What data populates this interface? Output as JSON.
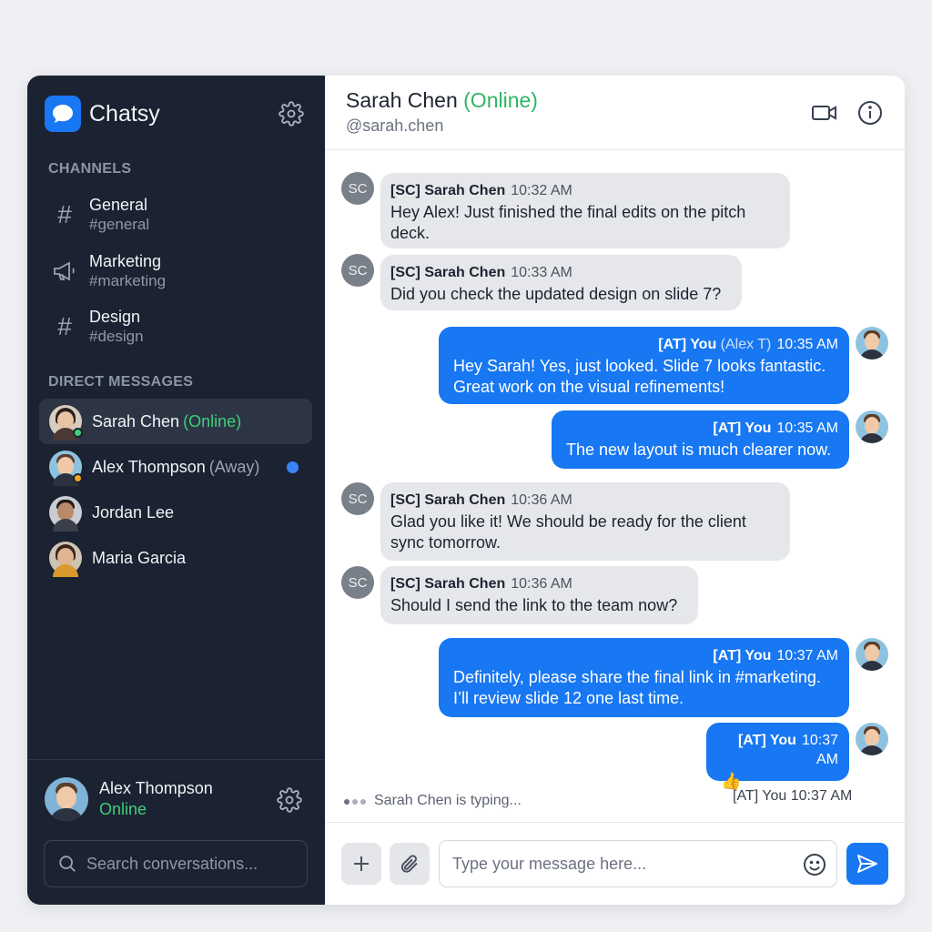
{
  "app": {
    "name": "Chatsy"
  },
  "sidebar": {
    "channels_title": "CHANNELS",
    "channels": [
      {
        "name": "General",
        "handle": "#general",
        "icon": "hash-icon"
      },
      {
        "name": "Marketing",
        "handle": "#marketing",
        "icon": "megaphone-icon"
      },
      {
        "name": "Design",
        "handle": "#design",
        "icon": "hash-icon"
      }
    ],
    "dm_title": "DIRECT MESSAGES",
    "dms": [
      {
        "name": "Sarah Chen",
        "status": "(Online)",
        "status_color": "#3ecf7a",
        "active": true
      },
      {
        "name": "Alex Thompson",
        "status": "(Away)",
        "status_color": "#9aa3b2",
        "unread": true
      },
      {
        "name": "Jordan Lee",
        "status": ""
      },
      {
        "name": "Maria Garcia",
        "status": ""
      }
    ],
    "me": {
      "name": "Alex Thompson",
      "status": "Online"
    },
    "search": {
      "placeholder": "Search conversations..."
    }
  },
  "conversation": {
    "title_name": "Sarah Chen",
    "title_status": "(Online)",
    "handle": "@sarah.chen",
    "messages": [
      {
        "from": "them",
        "initials": "SC",
        "sender": "[SC] Sarah Chen",
        "time": "10:32 AM",
        "lines": [
          "Hey Alex! Just finished the final edits on the pitch",
          "deck."
        ]
      },
      {
        "from": "them",
        "initials": "SC",
        "sender": "[SC] Sarah Chen",
        "time": "10:33 AM",
        "lines": [
          "Did you check the updated design on slide 7?"
        ]
      },
      {
        "from": "me",
        "sender": "[AT] You",
        "sender_extra": "(Alex T)",
        "time": "10:35 AM",
        "lines": [
          "Hey Sarah! Yes, just looked. Slide 7 looks fantastic.",
          "Great work on the visual refinements!"
        ]
      },
      {
        "from": "me",
        "sender": "[AT] You",
        "time": "10:35 AM",
        "lines": [
          "The new layout is much clearer now."
        ]
      },
      {
        "from": "them",
        "initials": "SC",
        "sender": "[SC] Sarah Chen",
        "time": "10:36 AM",
        "lines": [
          "Glad you like it! We should be ready for the client",
          "sync tomorrow."
        ]
      },
      {
        "from": "them",
        "initials": "SC",
        "sender": "[SC] Sarah Chen",
        "time": "10:36 AM",
        "lines": [
          "Should I send the link to the team now?"
        ]
      },
      {
        "from": "me",
        "sender": "[AT] You",
        "time": "10:37 AM",
        "lines": [
          "Definitely, please share the final link in #marketing.",
          "I’ll review slide 12 one last time."
        ]
      },
      {
        "from": "me",
        "sender": "[AT] You",
        "time": "10:37 AM",
        "lines": [
          "👍"
        ]
      }
    ],
    "typing": "Sarah Chen is typing...",
    "last_meta": "[AT] You 10:37 AM"
  },
  "composer": {
    "placeholder": "Type your message here..."
  },
  "colors": {
    "accent": "#1877f2",
    "sidebar_bg": "#1b2231",
    "online": "#2fb565"
  }
}
